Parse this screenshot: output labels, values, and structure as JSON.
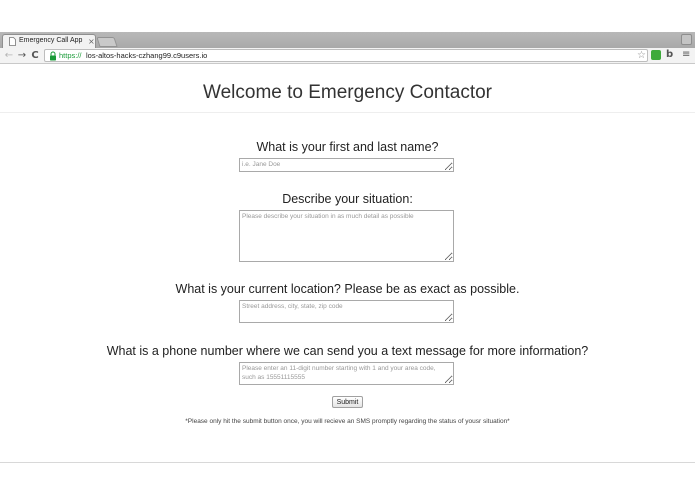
{
  "browser": {
    "tab": {
      "title": "Emergency Call App",
      "close": "×"
    },
    "toolbar": {
      "back": "←",
      "forward": "→",
      "reload": "C",
      "url_scheme": "https://",
      "url_host": "los-altos-hacks-czhang99.c9users.io",
      "star": "☆",
      "ext_bing": "b",
      "menu": "≡"
    },
    "icons": [
      "document-icon",
      "lock-icon",
      "star-icon",
      "extension-icon",
      "bing-icon",
      "menu-icon"
    ]
  },
  "page": {
    "title": "Welcome to Emergency Contactor",
    "form": {
      "name": {
        "label": "What is your first and last name?",
        "placeholder": "i.e. Jane Doe",
        "value": ""
      },
      "situation": {
        "label": "Describe your situation:",
        "placeholder": "Please describe your situation in as much detail as possible",
        "value": ""
      },
      "location": {
        "label": "What is your current location? Please be as exact as possible.",
        "placeholder": "Street address, city, state, zip code",
        "value": ""
      },
      "phone": {
        "label": "What is a phone number where we can send you a text message for more information?",
        "placeholder": "Please enter an 11-digit number starting with 1 and your area code, such as 15551115555",
        "value": ""
      },
      "submit_label": "Submit"
    },
    "note": "*Please only hit the submit button once, you will recieve an SMS promptly regarding the status of yousr situation*"
  },
  "colors": {
    "secure_green": "#1a9b38",
    "text": "#333333",
    "tabstrip": "#ababab"
  }
}
